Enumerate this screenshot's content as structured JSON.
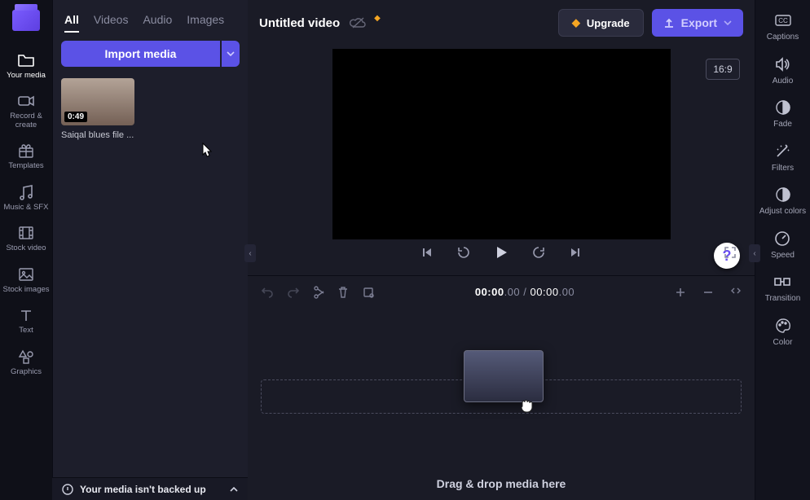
{
  "nav": {
    "items": [
      {
        "label": "Your media",
        "icon": "folder-icon",
        "active": true
      },
      {
        "label": "Record & create",
        "icon": "camera-icon"
      },
      {
        "label": "Templates",
        "icon": "gift-icon"
      },
      {
        "label": "Music & SFX",
        "icon": "music-icon"
      },
      {
        "label": "Stock video",
        "icon": "film-icon"
      },
      {
        "label": "Stock images",
        "icon": "image-icon"
      },
      {
        "label": "Text",
        "icon": "text-icon"
      },
      {
        "label": "Graphics",
        "icon": "shapes-icon"
      }
    ]
  },
  "panel": {
    "tabs": [
      "All",
      "Videos",
      "Audio",
      "Images"
    ],
    "active_tab": 0,
    "import_label": "Import media",
    "media": [
      {
        "duration": "0:49",
        "label": "Saiqal blues file ..."
      }
    ]
  },
  "backup": {
    "message": "Your media isn't backed up"
  },
  "topbar": {
    "title": "Untitled video",
    "upgrade_label": "Upgrade",
    "export_label": "Export"
  },
  "preview": {
    "aspect_label": "16:9"
  },
  "timecode": {
    "current": "00:00",
    "current_frames": ".00",
    "total": "00:00",
    "total_frames": ".00"
  },
  "timeline": {
    "drop_hint": "Drag & drop media here"
  },
  "rail": {
    "items": [
      {
        "label": "Captions",
        "icon": "captions-icon"
      },
      {
        "label": "Audio",
        "icon": "speaker-icon"
      },
      {
        "label": "Fade",
        "icon": "fade-icon"
      },
      {
        "label": "Filters",
        "icon": "wand-icon"
      },
      {
        "label": "Adjust colors",
        "icon": "contrast-icon"
      },
      {
        "label": "Speed",
        "icon": "gauge-icon"
      },
      {
        "label": "Transition",
        "icon": "transition-icon"
      },
      {
        "label": "Color",
        "icon": "palette-icon"
      }
    ]
  },
  "icons": {
    "diamond": "◆",
    "question": "?"
  }
}
